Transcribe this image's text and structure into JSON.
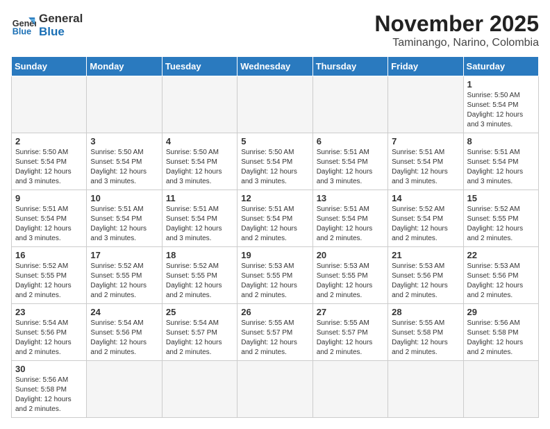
{
  "logo": {
    "text_general": "General",
    "text_blue": "Blue"
  },
  "title": "November 2025",
  "location": "Taminango, Narino, Colombia",
  "days_of_week": [
    "Sunday",
    "Monday",
    "Tuesday",
    "Wednesday",
    "Thursday",
    "Friday",
    "Saturday"
  ],
  "weeks": [
    [
      {
        "day": "",
        "info": ""
      },
      {
        "day": "",
        "info": ""
      },
      {
        "day": "",
        "info": ""
      },
      {
        "day": "",
        "info": ""
      },
      {
        "day": "",
        "info": ""
      },
      {
        "day": "",
        "info": ""
      },
      {
        "day": "1",
        "info": "Sunrise: 5:50 AM\nSunset: 5:54 PM\nDaylight: 12 hours and 3 minutes."
      }
    ],
    [
      {
        "day": "2",
        "info": "Sunrise: 5:50 AM\nSunset: 5:54 PM\nDaylight: 12 hours and 3 minutes."
      },
      {
        "day": "3",
        "info": "Sunrise: 5:50 AM\nSunset: 5:54 PM\nDaylight: 12 hours and 3 minutes."
      },
      {
        "day": "4",
        "info": "Sunrise: 5:50 AM\nSunset: 5:54 PM\nDaylight: 12 hours and 3 minutes."
      },
      {
        "day": "5",
        "info": "Sunrise: 5:50 AM\nSunset: 5:54 PM\nDaylight: 12 hours and 3 minutes."
      },
      {
        "day": "6",
        "info": "Sunrise: 5:51 AM\nSunset: 5:54 PM\nDaylight: 12 hours and 3 minutes."
      },
      {
        "day": "7",
        "info": "Sunrise: 5:51 AM\nSunset: 5:54 PM\nDaylight: 12 hours and 3 minutes."
      },
      {
        "day": "8",
        "info": "Sunrise: 5:51 AM\nSunset: 5:54 PM\nDaylight: 12 hours and 3 minutes."
      }
    ],
    [
      {
        "day": "9",
        "info": "Sunrise: 5:51 AM\nSunset: 5:54 PM\nDaylight: 12 hours and 3 minutes."
      },
      {
        "day": "10",
        "info": "Sunrise: 5:51 AM\nSunset: 5:54 PM\nDaylight: 12 hours and 3 minutes."
      },
      {
        "day": "11",
        "info": "Sunrise: 5:51 AM\nSunset: 5:54 PM\nDaylight: 12 hours and 3 minutes."
      },
      {
        "day": "12",
        "info": "Sunrise: 5:51 AM\nSunset: 5:54 PM\nDaylight: 12 hours and 2 minutes."
      },
      {
        "day": "13",
        "info": "Sunrise: 5:51 AM\nSunset: 5:54 PM\nDaylight: 12 hours and 2 minutes."
      },
      {
        "day": "14",
        "info": "Sunrise: 5:52 AM\nSunset: 5:54 PM\nDaylight: 12 hours and 2 minutes."
      },
      {
        "day": "15",
        "info": "Sunrise: 5:52 AM\nSunset: 5:55 PM\nDaylight: 12 hours and 2 minutes."
      }
    ],
    [
      {
        "day": "16",
        "info": "Sunrise: 5:52 AM\nSunset: 5:55 PM\nDaylight: 12 hours and 2 minutes."
      },
      {
        "day": "17",
        "info": "Sunrise: 5:52 AM\nSunset: 5:55 PM\nDaylight: 12 hours and 2 minutes."
      },
      {
        "day": "18",
        "info": "Sunrise: 5:52 AM\nSunset: 5:55 PM\nDaylight: 12 hours and 2 minutes."
      },
      {
        "day": "19",
        "info": "Sunrise: 5:53 AM\nSunset: 5:55 PM\nDaylight: 12 hours and 2 minutes."
      },
      {
        "day": "20",
        "info": "Sunrise: 5:53 AM\nSunset: 5:55 PM\nDaylight: 12 hours and 2 minutes."
      },
      {
        "day": "21",
        "info": "Sunrise: 5:53 AM\nSunset: 5:56 PM\nDaylight: 12 hours and 2 minutes."
      },
      {
        "day": "22",
        "info": "Sunrise: 5:53 AM\nSunset: 5:56 PM\nDaylight: 12 hours and 2 minutes."
      }
    ],
    [
      {
        "day": "23",
        "info": "Sunrise: 5:54 AM\nSunset: 5:56 PM\nDaylight: 12 hours and 2 minutes."
      },
      {
        "day": "24",
        "info": "Sunrise: 5:54 AM\nSunset: 5:56 PM\nDaylight: 12 hours and 2 minutes."
      },
      {
        "day": "25",
        "info": "Sunrise: 5:54 AM\nSunset: 5:57 PM\nDaylight: 12 hours and 2 minutes."
      },
      {
        "day": "26",
        "info": "Sunrise: 5:55 AM\nSunset: 5:57 PM\nDaylight: 12 hours and 2 minutes."
      },
      {
        "day": "27",
        "info": "Sunrise: 5:55 AM\nSunset: 5:57 PM\nDaylight: 12 hours and 2 minutes."
      },
      {
        "day": "28",
        "info": "Sunrise: 5:55 AM\nSunset: 5:58 PM\nDaylight: 12 hours and 2 minutes."
      },
      {
        "day": "29",
        "info": "Sunrise: 5:56 AM\nSunset: 5:58 PM\nDaylight: 12 hours and 2 minutes."
      }
    ],
    [
      {
        "day": "30",
        "info": "Sunrise: 5:56 AM\nSunset: 5:58 PM\nDaylight: 12 hours and 2 minutes."
      },
      {
        "day": "",
        "info": ""
      },
      {
        "day": "",
        "info": ""
      },
      {
        "day": "",
        "info": ""
      },
      {
        "day": "",
        "info": ""
      },
      {
        "day": "",
        "info": ""
      },
      {
        "day": "",
        "info": ""
      }
    ]
  ]
}
